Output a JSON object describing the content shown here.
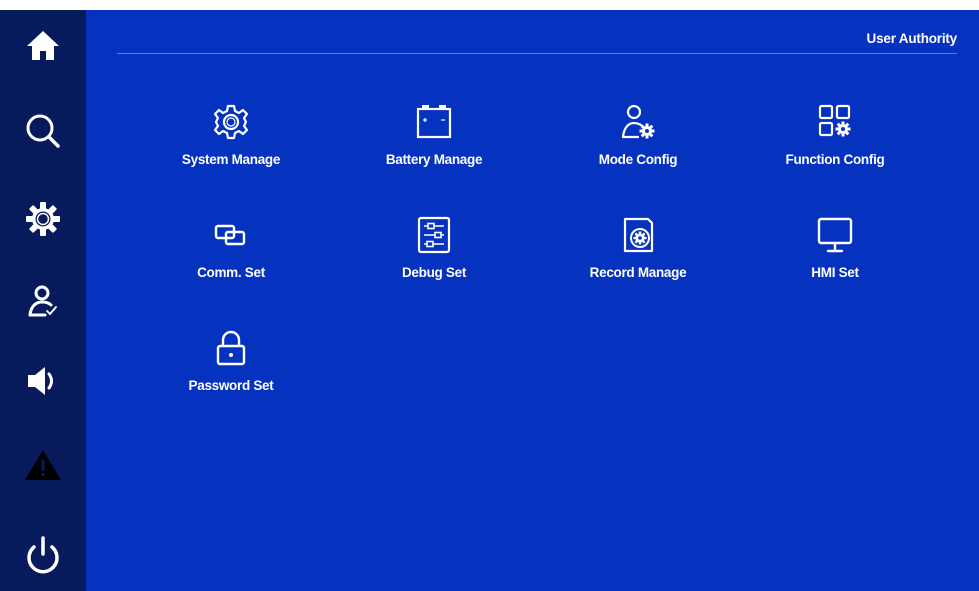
{
  "header": {
    "title": "User Authority"
  },
  "sidebar": {
    "items": [
      {
        "name": "home",
        "icon": "home-icon"
      },
      {
        "name": "search",
        "icon": "search-icon"
      },
      {
        "name": "settings",
        "icon": "gear-icon"
      },
      {
        "name": "user",
        "icon": "user-check-icon"
      },
      {
        "name": "sound",
        "icon": "speaker-icon"
      },
      {
        "name": "alarm",
        "icon": "warning-icon"
      },
      {
        "name": "power",
        "icon": "power-icon"
      }
    ]
  },
  "menu": {
    "items": [
      {
        "label": "System Manage",
        "icon": "gear-icon"
      },
      {
        "label": "Battery Manage",
        "icon": "battery-icon"
      },
      {
        "label": "Mode Config",
        "icon": "user-gear-icon"
      },
      {
        "label": "Function Config",
        "icon": "grid-gear-icon"
      },
      {
        "label": "Comm. Set",
        "icon": "link-windows-icon"
      },
      {
        "label": "Debug Set",
        "icon": "sliders-icon"
      },
      {
        "label": "Record Manage",
        "icon": "record-gear-icon"
      },
      {
        "label": "HMI Set",
        "icon": "monitor-icon"
      },
      {
        "label": "Password Set",
        "icon": "lock-icon"
      }
    ]
  },
  "colors": {
    "sidebar_bg": "#061a5c",
    "main_bg": "#0632c0",
    "text": "#ffffff"
  }
}
